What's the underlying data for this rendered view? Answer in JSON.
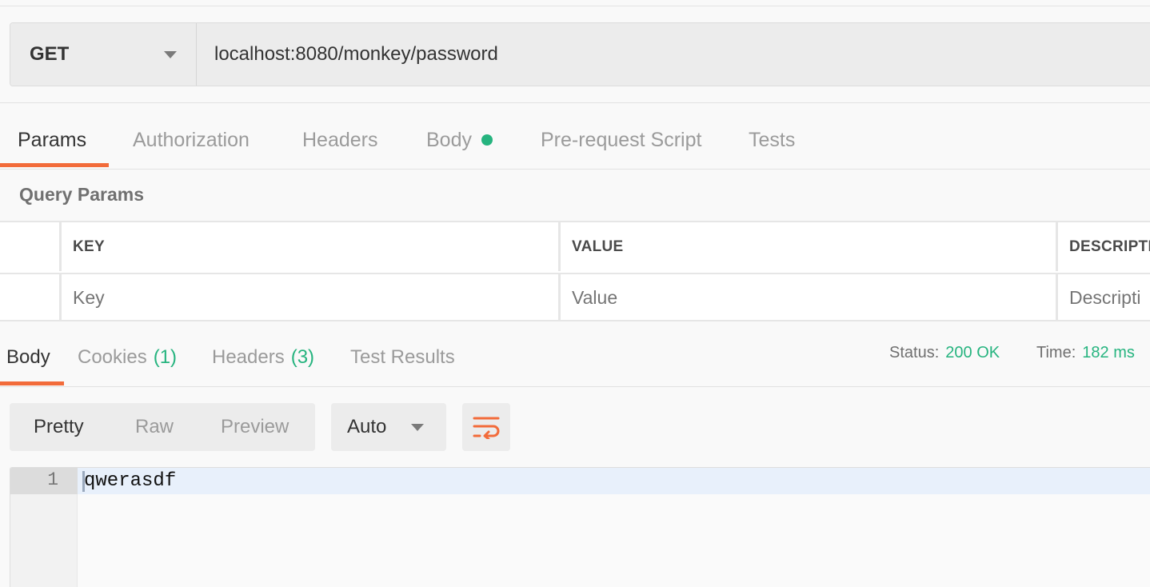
{
  "request": {
    "method": "GET",
    "url": "localhost:8080/monkey/password"
  },
  "request_tabs": [
    {
      "label": "Params",
      "active": true
    },
    {
      "label": "Authorization",
      "active": false
    },
    {
      "label": "Headers",
      "active": false
    },
    {
      "label": "Body",
      "active": false,
      "indicator": "green-dot"
    },
    {
      "label": "Pre-request Script",
      "active": false
    },
    {
      "label": "Tests",
      "active": false
    }
  ],
  "query_params": {
    "title": "Query Params",
    "columns": [
      "KEY",
      "VALUE",
      "DESCRIPTIO"
    ],
    "placeholders": {
      "key": "Key",
      "value": "Value",
      "description": "Descripti"
    }
  },
  "response_tabs": [
    {
      "label": "Body",
      "active": true
    },
    {
      "label": "Cookies",
      "count": "(1)",
      "active": false
    },
    {
      "label": "Headers",
      "count": "(3)",
      "active": false
    },
    {
      "label": "Test Results",
      "active": false
    }
  ],
  "status": {
    "label": "Status:",
    "value": "200 OK"
  },
  "time": {
    "label": "Time:",
    "value": "182 ms"
  },
  "view_modes": [
    {
      "label": "Pretty",
      "active": true
    },
    {
      "label": "Raw",
      "active": false
    },
    {
      "label": "Preview",
      "active": false
    }
  ],
  "format": {
    "selected": "Auto"
  },
  "wrap_icon": "wrap-lines-icon",
  "editor": {
    "lines": [
      {
        "number": "1",
        "text": "qwerasdf"
      }
    ]
  },
  "colors": {
    "accent": "#f26b3a",
    "success": "#26b47f"
  }
}
